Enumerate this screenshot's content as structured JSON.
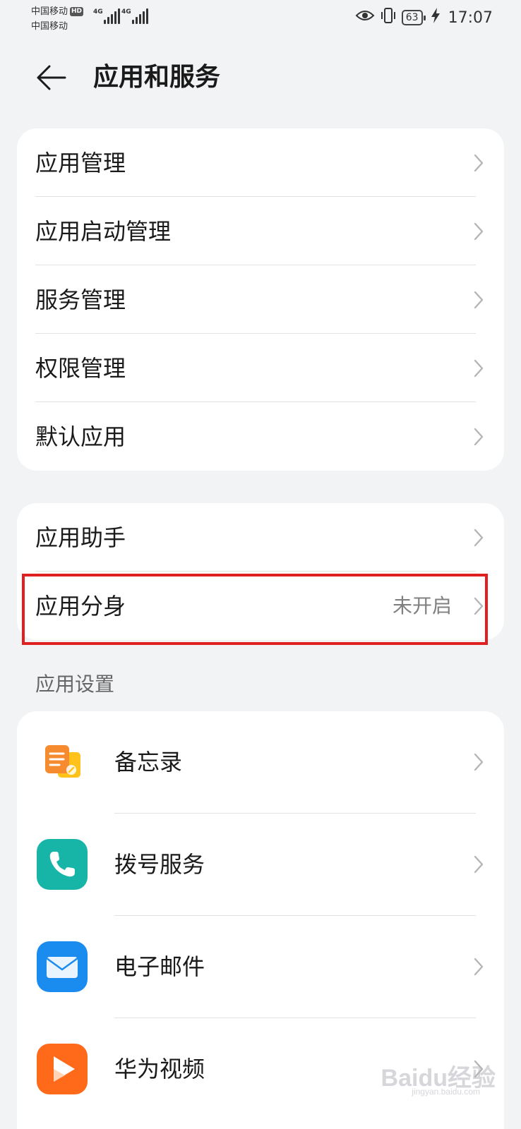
{
  "status_bar": {
    "carrier1": "中国移动",
    "carrier1_badge": "HD",
    "carrier2": "中国移动",
    "net1": "4G",
    "net2": "4G",
    "battery": "63",
    "time": "17:07"
  },
  "header": {
    "title": "应用和服务"
  },
  "group1": {
    "items": [
      {
        "label": "应用管理"
      },
      {
        "label": "应用启动管理"
      },
      {
        "label": "服务管理"
      },
      {
        "label": "权限管理"
      },
      {
        "label": "默认应用"
      }
    ]
  },
  "group2": {
    "items": [
      {
        "label": "应用助手",
        "value": ""
      },
      {
        "label": "应用分身",
        "value": "未开启"
      }
    ]
  },
  "app_settings": {
    "section_label": "应用设置",
    "apps": [
      {
        "label": "备忘录",
        "icon": "notepad-icon",
        "color": "#f58a2f"
      },
      {
        "label": "拨号服务",
        "icon": "phone-icon",
        "color": "#16b5a8"
      },
      {
        "label": "电子邮件",
        "icon": "mail-icon",
        "color": "#1a8cf0"
      },
      {
        "label": "华为视频",
        "icon": "video-play-icon",
        "color": "#ff6a1a"
      }
    ]
  },
  "watermark": {
    "text": "Baidu经验",
    "sub": "jingyan.baidu.com"
  }
}
